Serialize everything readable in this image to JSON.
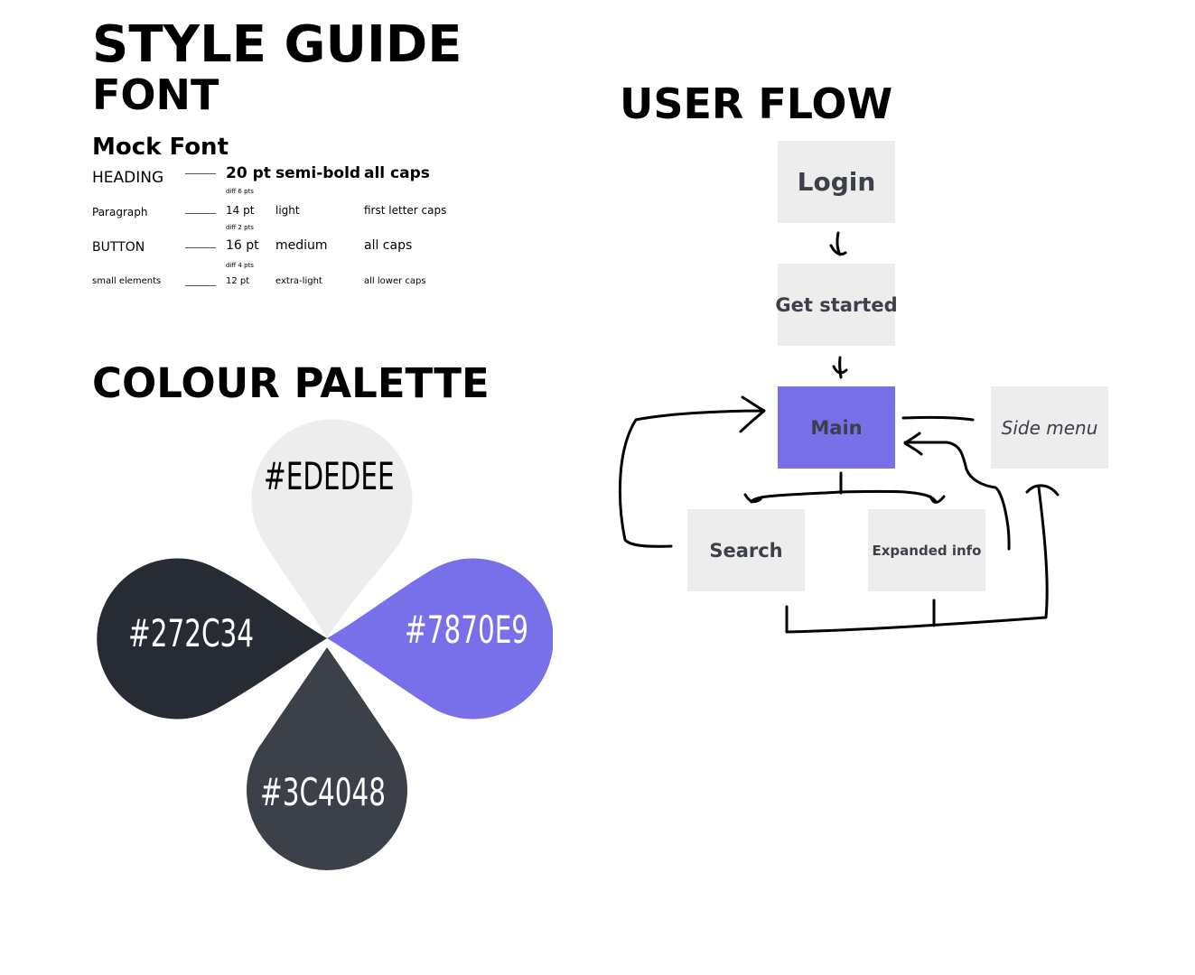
{
  "style_guide": {
    "title": "STYLE GUIDE",
    "font_heading": "FONT",
    "font_name": "Mock Font",
    "rows": [
      {
        "name": "HEADING",
        "size": "20 pt",
        "weight": "semi-bold",
        "caps": "all caps",
        "diff": "diff 6 pts"
      },
      {
        "name": "Paragraph",
        "size": "14 pt",
        "weight": "light",
        "caps": "first letter caps",
        "diff": "diff 2 pts"
      },
      {
        "name": "BUTTON",
        "size": "16 pt",
        "weight": "medium",
        "caps": "all caps",
        "diff": "diff 4 pts"
      },
      {
        "name": "small elements",
        "size": "12 pt",
        "weight": "extra-light",
        "caps": "all lower caps"
      }
    ]
  },
  "palette": {
    "heading": "COLOUR PALETTE",
    "colors": [
      {
        "label": "#EDEDEE",
        "hex": "#EDEDEE",
        "text_color": "#000000"
      },
      {
        "label": "#272C34",
        "hex": "#272C34",
        "text_color": "#FFFFFF"
      },
      {
        "label": "#7870E9",
        "hex": "#7870E9",
        "text_color": "#FFFFFF"
      },
      {
        "label": "#3C4048",
        "hex": "#3C4048",
        "text_color": "#FFFFFF"
      }
    ]
  },
  "user_flow": {
    "heading": "USER FLOW",
    "nodes": {
      "login": "Login",
      "get_started": "Get started",
      "main": "Main",
      "side_menu": "Side menu",
      "search": "Search",
      "expanded_info": "Expanded info"
    }
  }
}
